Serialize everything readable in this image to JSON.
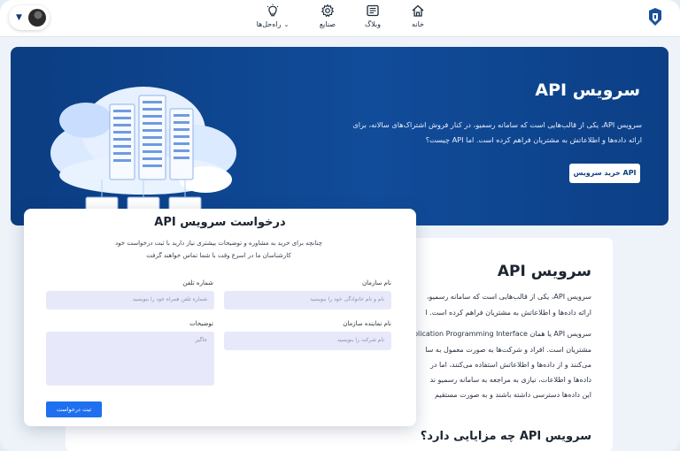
{
  "nav": {
    "home": "خانه",
    "blog": "وبلاگ",
    "industries": "صنایع",
    "solutions": "راه‌حل‌ها"
  },
  "hero": {
    "title": "سرویس API",
    "desc_line1": "سرویس API، یکی از قالب‌هایی است که سامانه رسمیو، در کنار فروش اشتراک‌های سالانه، برای",
    "desc_line2": "ارائه داده‌ها و اطلاعاتش به مشتریان فراهم کرده است. اما API چیست؟",
    "buy_button": "خرید سرویس API"
  },
  "article": {
    "title": "سرویس API",
    "p1_line1": "سرویس API، یکی از قالب‌هایی است که سامانه رسمیو،",
    "p1_line2": "ارائه داده‌ها و اطلاعاتش به مشتریان فراهم کرده است. ا",
    "p2_line1": "سرویس API یا همان Application Programming Interface",
    "p2_line2": "مشتریان است. افراد و شرکت‌ها به صورت معمول به سا",
    "p2_line3": "می‌کنند و از داده‌ها و اطلاعاتش استفاده می‌کنند، اما در",
    "p2_line4": "داده‌ها و اطلاعات، نیازی به مراجعه به سامانه رسمیو ند",
    "p2_line5": "این داده‌ها دسترسی داشته باشند و به صورت مستقیم",
    "h2": "سرویس API چه مزایایی دارد؟"
  },
  "modal": {
    "title": "درخواست سرویس API",
    "subtitle_line1": "چنانچه برای خرید به مشاوره و توضیحات بیشتری نیاز دارید با ثبت درخواست خود",
    "subtitle_line2": "کارشناسان ما در اسرع وقت با شما تماس خواهند گرفت",
    "org_label": "نام سازمان",
    "org_placeholder": "نام و نام خانوادگی خود را بنویسید",
    "phone_label": "شماره تلفن",
    "phone_placeholder": "شماره تلفن همراه خود را بنویسید",
    "rep_label": "نام نماینده سازمان",
    "rep_placeholder": "نام شرکت را بنویسید",
    "desc_label": "توضیحات",
    "desc_placeholder": "جاگیر",
    "submit": "ثبت درخواست"
  },
  "colors": {
    "hero_bg": "#0f468f",
    "accent": "#1f6ff0",
    "input_bg": "#e7e9fb"
  }
}
